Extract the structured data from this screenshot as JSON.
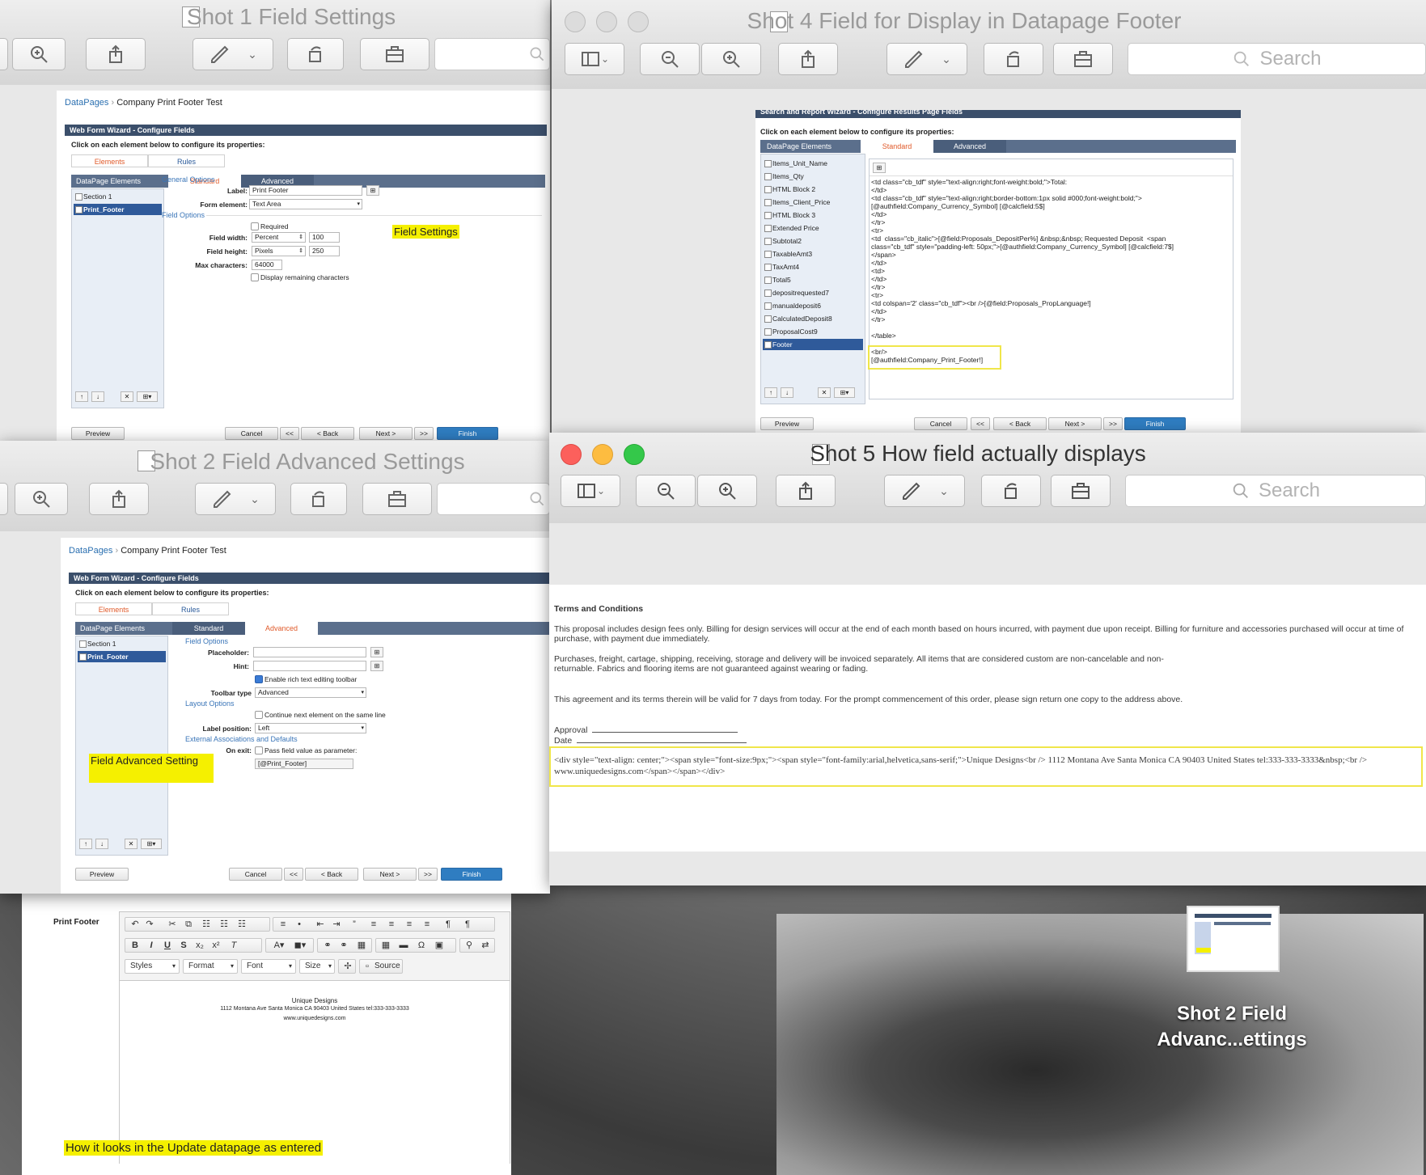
{
  "colors": {
    "highlight": "#f5f000",
    "wizard_header": "#3b4f6b",
    "finish_button": "#2f7dc1",
    "tab_active": "#e05a2a",
    "link": "#2a6fb0"
  },
  "windows": {
    "shot1": {
      "title": "Shot 1 Field Settings",
      "breadcrumb_link": "DataPages",
      "breadcrumb_page": "Company Print Footer Test",
      "wizard_header": "Web Form Wizard - Configure Fields",
      "instruction": "Click on each element below to configure its properties:",
      "tab_elements": "Elements",
      "tab_rules": "Rules",
      "panel_title": "DataPage Elements",
      "tab_standard": "Standard",
      "tab_advanced": "Advanced",
      "tree": [
        "Section 1",
        "Print_Footer"
      ],
      "general_options": "General Options",
      "label_lbl": "Label:",
      "label_value": "Print Footer",
      "form_element_lbl": "Form element:",
      "form_element_value": "Text Area",
      "field_options": "Field Options",
      "required": "Required",
      "field_width_lbl": "Field width:",
      "field_width_unit": "Percent",
      "field_width_value": "100",
      "field_height_lbl": "Field height:",
      "field_height_unit": "Pixels",
      "field_height_value": "250",
      "max_chars_lbl": "Max characters:",
      "max_chars_value": "64000",
      "display_remaining": "Display remaining characters",
      "annotation": "Field Settings",
      "buttons": {
        "preview": "Preview",
        "cancel": "Cancel",
        "first": "<<",
        "back": "< Back",
        "next": "Next >",
        "last": ">>",
        "finish": "Finish"
      }
    },
    "shot2": {
      "title": "Shot 2 Field Advanced Settings",
      "breadcrumb_link": "DataPages",
      "breadcrumb_page": "Company Print Footer Test",
      "wizard_header": "Web Form Wizard - Configure Fields",
      "instruction": "Click on each element below to configure its properties:",
      "tab_elements": "Elements",
      "tab_rules": "Rules",
      "panel_title": "DataPage Elements",
      "tab_standard": "Standard",
      "tab_advanced": "Advanced",
      "tree": [
        "Section 1",
        "Print_Footer"
      ],
      "field_options": "Field Options",
      "placeholder_lbl": "Placeholder:",
      "hint_lbl": "Hint:",
      "rich_text": "Enable rich text editing toolbar",
      "toolbar_type_lbl": "Toolbar type",
      "toolbar_type_value": "Advanced",
      "layout_options": "Layout Options",
      "continue_next": "Continue next element on the same line",
      "label_position_lbl": "Label position:",
      "label_position_value": "Left",
      "external": "External Associations and Defaults",
      "on_exit_lbl": "On exit:",
      "pass_field": "Pass field value as parameter:",
      "param_value": "[@Print_Footer]",
      "annotation": "Field Advanced Setting",
      "buttons": {
        "preview": "Preview",
        "cancel": "Cancel",
        "first": "<<",
        "back": "< Back",
        "next": "Next >",
        "last": ">>",
        "finish": "Finish"
      }
    },
    "shot3": {
      "field_label": "Print Footer",
      "toolbar_row3": {
        "styles": "Styles",
        "format": "Format",
        "font": "Font",
        "size": "Size",
        "source": "Source"
      },
      "content_line1": "Unique Designs",
      "content_line2": "1112 Montana Ave Santa Monica CA 90403 United States tel:333-333-3333",
      "content_line3": "www.uniquedesigns.com",
      "annotation": "How it looks in the Update datapage as entered"
    },
    "shot4": {
      "title": "Shot 4 Field for Display in Datapage Footer",
      "search": "Search",
      "wizard_header": "Search and Report Wizard - Configure Results Page Fields",
      "instruction": "Click on each element below to configure its properties:",
      "panel_title": "DataPage Elements",
      "tab_standard": "Standard",
      "tab_advanced": "Advanced",
      "tree": [
        "Items_Unit_Name",
        "Items_Qty",
        "HTML Block 2",
        "Items_Client_Price",
        "HTML Block 3",
        "Extended Price",
        "Subtotal2",
        "TaxableAmt3",
        "TaxAmt4",
        "Total5",
        "depositrequested7",
        "manualdeposit6",
        "CalculatedDeposit8",
        "ProposalCost9",
        "Footer"
      ],
      "code_lines": [
        "<td class=\"cb_tdf\" style=\"text-align:right;font-weight:bold;\">Total:",
        "</td>",
        "<td class=\"cb_tdf\" style=\"text-align:right;border-bottom:1px solid #000;font-weight:bold;\">",
        "[@authfield:Company_Currency_Symbol] [@calcfield:5$]",
        "</td>",
        "</tr>",
        "<tr>",
        "<td  class=\"cb_italic\">[@field:Proposals_DepositPer%] &nbsp;&nbsp; Requested Deposit  <span",
        "class=\"cb_tdf\" style=\"padding-left: 50px;\">[@authfield:Company_Currency_Symbol] [@calcfield:7$]",
        "</span>",
        "</td>",
        "<td>",
        "</td>",
        "</tr>",
        "<tr>",
        "<td colspan='2' class=\"cb_tdf\"><br />[@field:Proposals_PropLanguage!]",
        "</td>",
        "</tr>",
        "",
        "</table>",
        "",
        "<br/>",
        "[@authfield:Company_Print_Footer!]"
      ],
      "buttons": {
        "preview": "Preview",
        "cancel": "Cancel",
        "first": "<<",
        "back": "< Back",
        "next": "Next >",
        "last": ">>",
        "finish": "Finish"
      }
    },
    "shot5": {
      "title": "Shot 5 How field actually displays",
      "search": "Search",
      "terms_heading": "Terms and Conditions",
      "para1": "This proposal includes design fees only. Billing for design services will occur at the end of each month based on hours incurred, with payment due upon receipt. Billing for furniture and accessories purchased will occur at time of purchase, with payment due immediately.",
      "para2": "Purchases, freight, cartage, shipping, receiving, storage and delivery will be invoiced separately. All items that are considered custom are non-cancelable and non-returnable. Fabrics and flooring items are not guaranteed against wearing or fading.",
      "para3": "This agreement and its terms therein will be valid for 7 days from today. For the prompt commencement of this order, please sign return one copy to the address above.",
      "approval": "Approval",
      "date": "Date",
      "raw_html": "<div style=\"text-align: center;\"><span style=\"font-size:9px;\"><span style=\"font-family:arial,helvetica,sans-serif;\">Unique Designs<br /> 1112 Montana Ave Santa Monica CA 90403 United States tel:333-333-3333&nbsp;<br /> www.uniquedesigns.com</span></span></div>"
    }
  },
  "desktop_thumbnail_caption": "Shot 2 Field Advanc...ettings"
}
